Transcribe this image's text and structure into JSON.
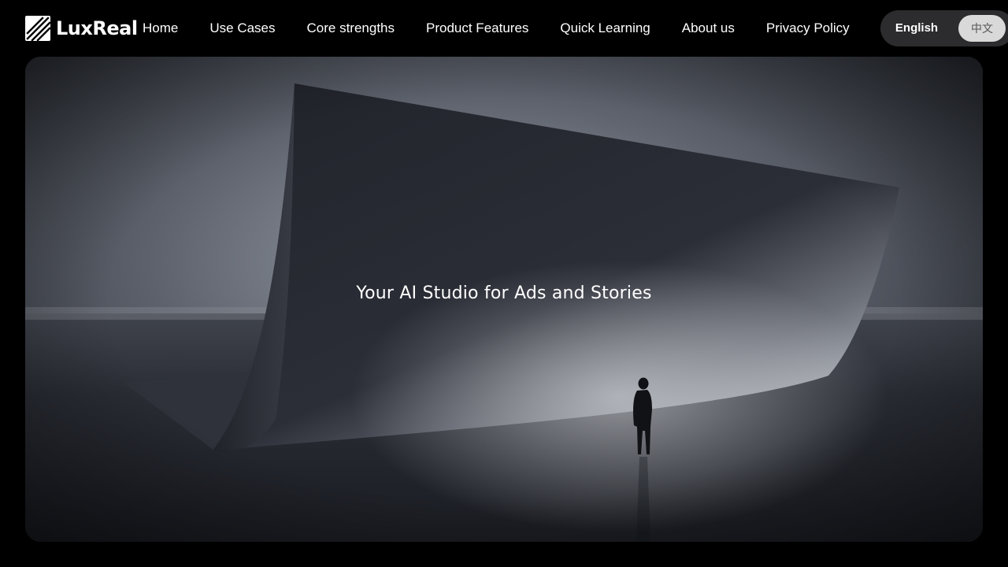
{
  "brand": {
    "name": "LuxReal",
    "logo_icon": "luxreal-stripes-logo"
  },
  "nav": {
    "items": [
      {
        "label": "Home"
      },
      {
        "label": "Use Cases"
      },
      {
        "label": "Core strengths"
      },
      {
        "label": "Product Features"
      },
      {
        "label": "Quick Learning"
      },
      {
        "label": "About us"
      },
      {
        "label": "Privacy Policy"
      }
    ]
  },
  "language": {
    "options": [
      {
        "label": "English",
        "active": true
      },
      {
        "label": "中文",
        "active": false
      }
    ]
  },
  "hero": {
    "title": "Your AI Studio for Ads and Stories",
    "image": "dark-curved-sheet-with-silhouette"
  },
  "colors": {
    "background": "#000000",
    "text": "#ffffff",
    "toggle_track": "#2c2c2e",
    "toggle_pill": "#d9d9d9"
  }
}
